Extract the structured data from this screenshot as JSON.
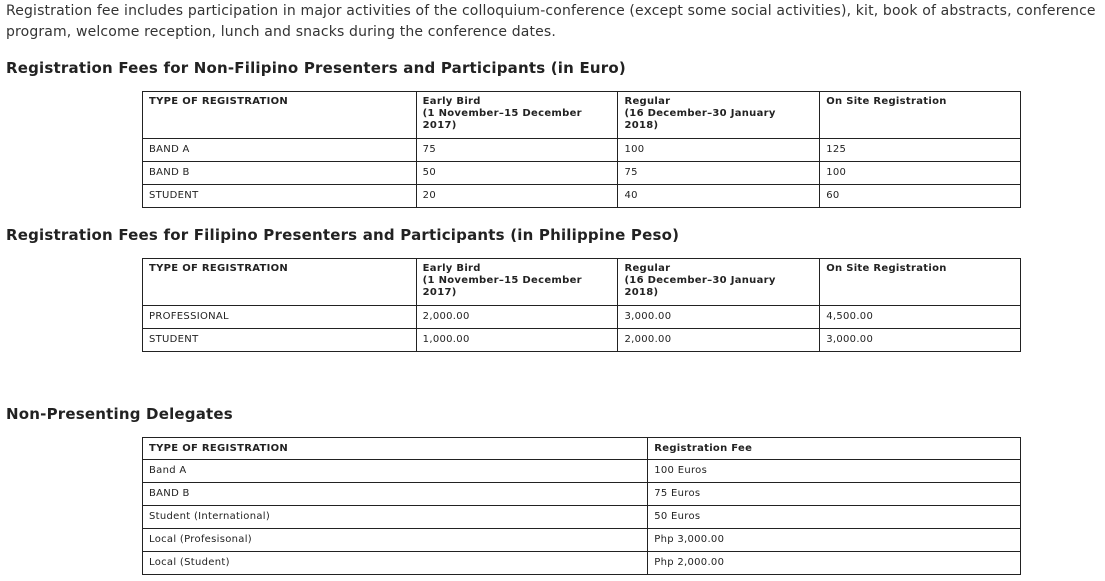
{
  "intro": "Registration fee includes participation in major activities of the colloquium-conference (except some social activities), kit, book of abstracts, conference program, welcome reception, lunch and snacks during the conference dates.",
  "section1": {
    "heading": "Registration Fees for Non-Filipino Presenters and Participants (in Euro)",
    "headers": [
      "TYPE OF REGISTRATION",
      "Early Bird\n(1 November–15 December 2017)",
      "Regular\n(16 December–30 January 2018)",
      "On Site Registration"
    ],
    "rows": [
      [
        "BAND A",
        "75",
        "100",
        "125"
      ],
      [
        "BAND B",
        "50",
        "75",
        "100"
      ],
      [
        "STUDENT",
        "20",
        "40",
        "60"
      ]
    ]
  },
  "section2": {
    "heading": "Registration Fees for Filipino Presenters and Participants (in Philippine Peso)",
    "headers": [
      "TYPE OF REGISTRATION",
      "Early Bird\n(1 November–15 December 2017)",
      "Regular\n(16 December–30 January 2018)",
      "On Site Registration"
    ],
    "rows": [
      [
        "PROFESSIONAL",
        "2,000.00",
        "3,000.00",
        "4,500.00"
      ],
      [
        "STUDENT",
        "1,000.00",
        "2,000.00",
        "3,000.00"
      ]
    ]
  },
  "section3": {
    "heading": "Non-Presenting Delegates",
    "headers": [
      "TYPE OF REGISTRATION",
      "Registration Fee"
    ],
    "rows": [
      [
        "Band A",
        "100 Euros"
      ],
      [
        "BAND B",
        "75 Euros"
      ],
      [
        "Student (International)",
        "50 Euros"
      ],
      [
        "Local (Profesisonal)",
        "Php 3,000.00"
      ],
      [
        "Local (Student)",
        "Php 2,000.00"
      ]
    ]
  }
}
